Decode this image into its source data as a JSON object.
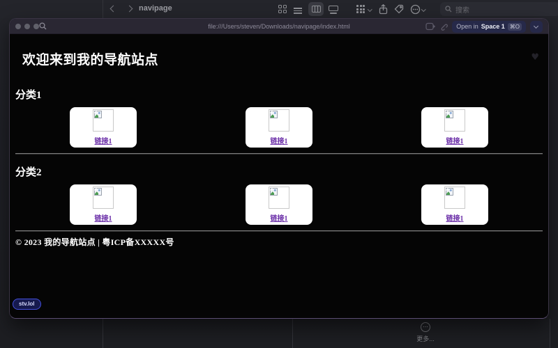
{
  "finder_toolbar": {
    "title": "navipage",
    "search_placeholder": "搜索"
  },
  "browser_window": {
    "url": "file:///Users/steven/Downloads/navipage/index.html",
    "open_in_label": "Open in",
    "space_label": "Space 1",
    "shortcut_badge": "⌘O"
  },
  "page": {
    "heading": "欢迎来到我的导航站点",
    "sections": [
      {
        "title": "分类1",
        "cards": [
          {
            "link": "链接1"
          },
          {
            "link": "链接1"
          },
          {
            "link": "链接1"
          }
        ]
      },
      {
        "title": "分类2",
        "cards": [
          {
            "link": "链接1"
          },
          {
            "link": "链接1"
          },
          {
            "link": "链接1"
          }
        ]
      }
    ],
    "footer": "© 2023 我的导航站点 | 粤ICP备XXXXX号",
    "badge": "stv.lol"
  },
  "finder_bottom": {
    "more_label": "更多...",
    "more_glyph": "⋯"
  },
  "icons": {
    "heart": "♥"
  },
  "colors": {
    "link_purple": "#6b2fa8",
    "card_bg": "#ffffff",
    "titlebar": "#2a2733",
    "page_bg": "#050505",
    "badge_border": "#4450dd",
    "toolbar_bg": "#24252b"
  }
}
